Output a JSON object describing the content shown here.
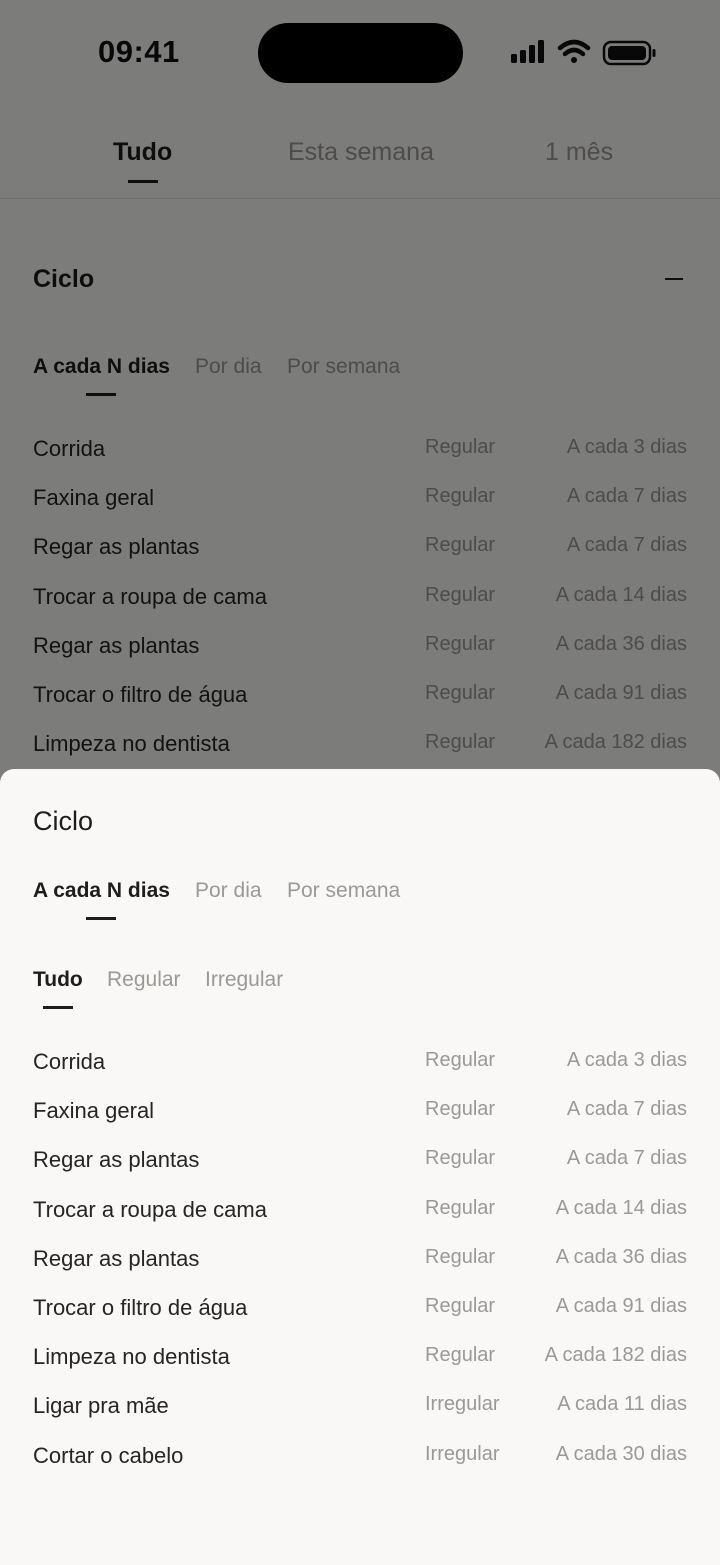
{
  "status_bar": {
    "time": "09:41"
  },
  "top_tabs": [
    {
      "label": "Tudo",
      "active": true
    },
    {
      "label": "Esta semana",
      "active": false
    },
    {
      "label": "1 mês",
      "active": false
    }
  ],
  "cycle_section": {
    "title": "Ciclo",
    "collapse_icon": "minus-icon",
    "sub_tabs": [
      {
        "label": "A cada N dias",
        "active": true
      },
      {
        "label": "Por dia",
        "active": false
      },
      {
        "label": "Por semana",
        "active": false
      }
    ],
    "rows": [
      {
        "name": "Corrida",
        "type": "Regular",
        "cycle": "A cada 3 dias"
      },
      {
        "name": "Faxina geral",
        "type": "Regular",
        "cycle": "A cada 7 dias"
      },
      {
        "name": "Regar as plantas",
        "type": "Regular",
        "cycle": "A cada 7 dias"
      },
      {
        "name": "Trocar a roupa de cama",
        "type": "Regular",
        "cycle": "A cada 14 dias"
      },
      {
        "name": "Regar as plantas",
        "type": "Regular",
        "cycle": "A cada 36 dias"
      },
      {
        "name": "Trocar o filtro de água",
        "type": "Regular",
        "cycle": "A cada 91 dias"
      },
      {
        "name": "Limpeza no dentista",
        "type": "Regular",
        "cycle": "A cada 182 dias"
      }
    ]
  },
  "sheet": {
    "title": "Ciclo",
    "sub_tabs": [
      {
        "label": "A cada N dias",
        "active": true
      },
      {
        "label": "Por dia",
        "active": false
      },
      {
        "label": "Por semana",
        "active": false
      }
    ],
    "filter_tabs": [
      {
        "label": "Tudo",
        "active": true
      },
      {
        "label": "Regular",
        "active": false
      },
      {
        "label": "Irregular",
        "active": false
      }
    ],
    "rows": [
      {
        "name": "Corrida",
        "type": "Regular",
        "cycle": "A cada 3 dias"
      },
      {
        "name": "Faxina geral",
        "type": "Regular",
        "cycle": "A cada 7 dias"
      },
      {
        "name": "Regar as plantas",
        "type": "Regular",
        "cycle": "A cada 7 dias"
      },
      {
        "name": "Trocar a roupa de cama",
        "type": "Regular",
        "cycle": "A cada 14 dias"
      },
      {
        "name": "Regar as plantas",
        "type": "Regular",
        "cycle": "A cada 36 dias"
      },
      {
        "name": "Trocar o filtro de água",
        "type": "Regular",
        "cycle": "A cada 91 dias"
      },
      {
        "name": "Limpeza no dentista",
        "type": "Regular",
        "cycle": "A cada 182 dias"
      },
      {
        "name": "Ligar pra mãe",
        "type": "Irregular",
        "cycle": "A cada 11 dias"
      },
      {
        "name": "Cortar o cabelo",
        "type": "Irregular",
        "cycle": "A cada 30 dias"
      }
    ]
  },
  "colors": {
    "background": "#f9f8f6",
    "text_primary": "#1d1d1b",
    "text_secondary": "#9a9996",
    "scrim": "rgba(0,0,0,0.5)"
  }
}
